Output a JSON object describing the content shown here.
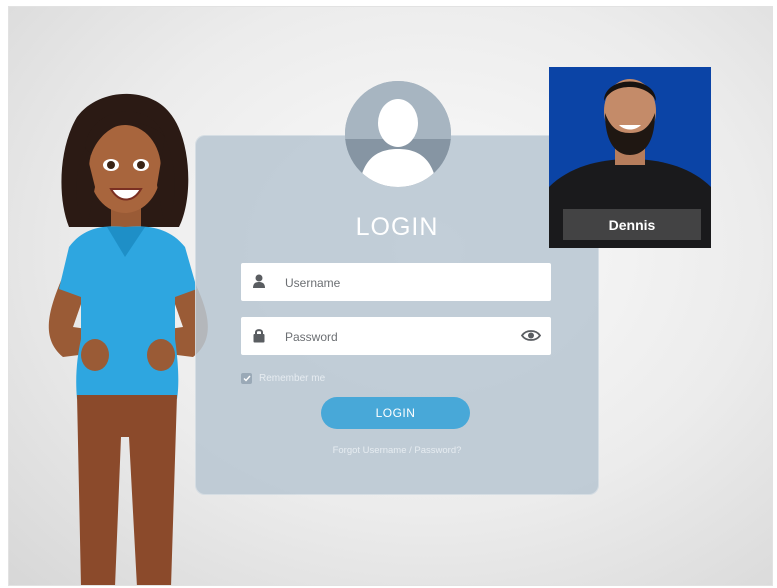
{
  "login": {
    "title": "LOGIN",
    "username_placeholder": "Username",
    "password_placeholder": "Password",
    "remember_label": "Remember me",
    "remember_checked": true,
    "button_label": "LOGIN",
    "forgot_link": "Forgot Username / Password?"
  },
  "person_card": {
    "name": "Dennis"
  },
  "icons": {
    "avatar": "user-silhouette-icon",
    "username": "user-icon",
    "password": "lock-icon",
    "show_password": "eye-icon",
    "checkbox": "checkmark-icon"
  },
  "colors": {
    "button": "#48a8d8",
    "card": "#b8c6d2",
    "photo_background": "#0b44a6"
  }
}
